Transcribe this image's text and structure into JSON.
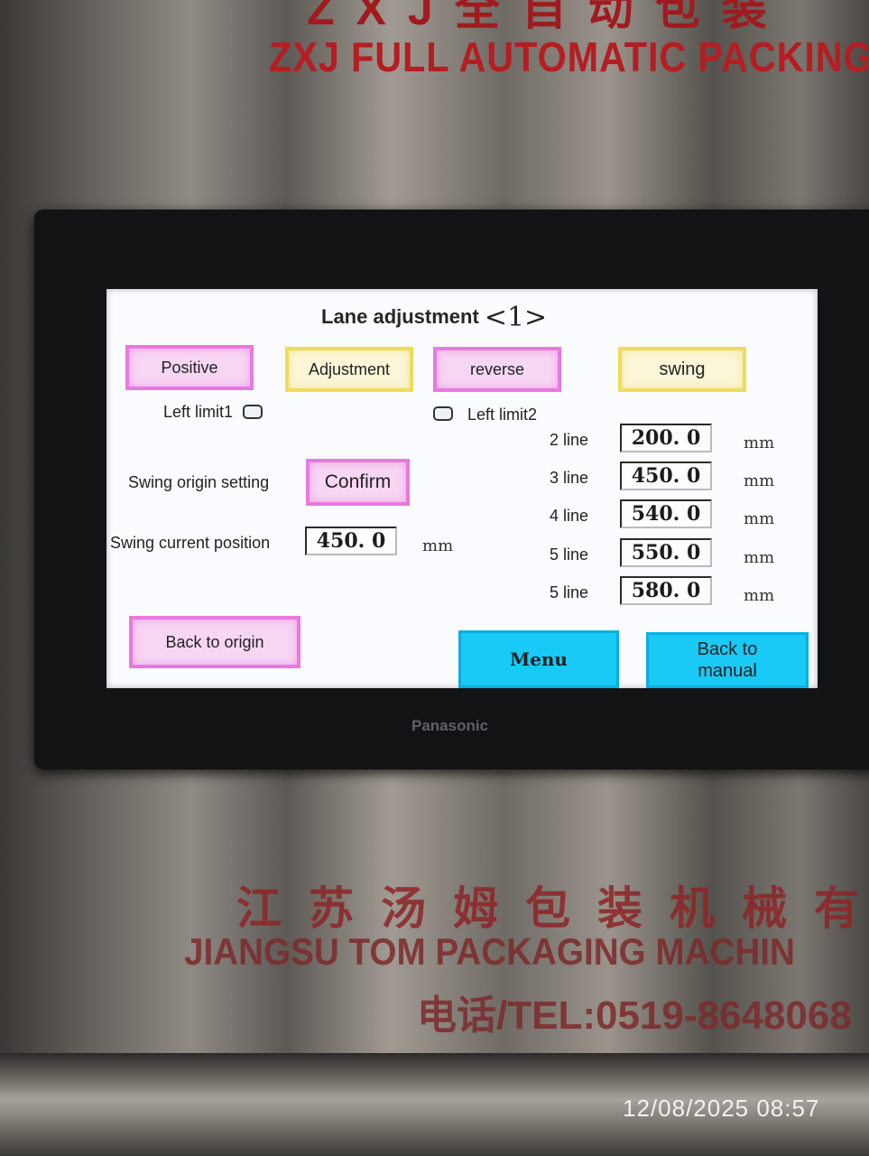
{
  "panel": {
    "header_cn": "ZXJ全自动包装",
    "header_en": "ZXJ FULL AUTOMATIC PACKING",
    "brand": "Panasonic",
    "footer_cn": "江苏汤姆包装机械有",
    "footer_en": "JIANGSU TOM PACKAGING MACHIN",
    "footer_tel": "电话/TEL:0519-8648068"
  },
  "screen": {
    "title": "Lane adjustment",
    "page_indicator": "<1>",
    "buttons": {
      "positive": "Positive",
      "adjustment": "Adjustment",
      "reverse": "reverse",
      "swing": "swing",
      "confirm": "Confirm",
      "back_to_origin": "Back to origin",
      "menu": "Menu",
      "back_to_manual": "Back to manual"
    },
    "left_limit1_label": "Left limit1",
    "left_limit2_label": "Left limit2",
    "swing_origin_label": "Swing origin setting",
    "swing_current_label": "Swing current position",
    "swing_current_value": "450. 0",
    "unit": "mm",
    "lines": [
      {
        "label": "2 line",
        "value": "200. 0"
      },
      {
        "label": "3 line",
        "value": "450. 0"
      },
      {
        "label": "4 line",
        "value": "540. 0"
      },
      {
        "label": "5 line",
        "value": "550. 0"
      },
      {
        "label": "5 line",
        "value": "580. 0"
      }
    ]
  },
  "timestamp": "12/08/2025 08:57",
  "colors": {
    "pink_button": "#ea78de",
    "yellow_button": "#efdc58",
    "cyan_button": "#19c9f6",
    "bezel": "#121314"
  }
}
